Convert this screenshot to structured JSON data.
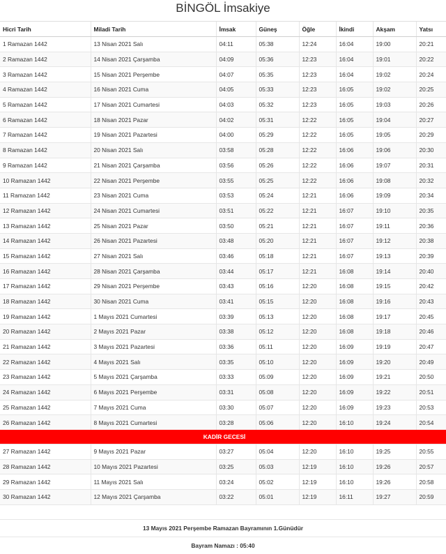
{
  "title": "BİNGÖL İmsakiye",
  "columns": [
    "Hicri Tarih",
    "Miladi Tarih",
    "İmsak",
    "Güneş",
    "Öğle",
    "İkindi",
    "Akşam",
    "Yatsı"
  ],
  "rows_before": [
    [
      "1 Ramazan 1442",
      "13 Nisan 2021 Salı",
      "04:11",
      "05:38",
      "12:24",
      "16:04",
      "19:00",
      "20:21"
    ],
    [
      "2 Ramazan 1442",
      "14 Nisan 2021 Çarşamba",
      "04:09",
      "05:36",
      "12:23",
      "16:04",
      "19:01",
      "20:22"
    ],
    [
      "3 Ramazan 1442",
      "15 Nisan 2021 Perşembe",
      "04:07",
      "05:35",
      "12:23",
      "16:04",
      "19:02",
      "20:24"
    ],
    [
      "4 Ramazan 1442",
      "16 Nisan 2021 Cuma",
      "04:05",
      "05:33",
      "12:23",
      "16:05",
      "19:02",
      "20:25"
    ],
    [
      "5 Ramazan 1442",
      "17 Nisan 2021 Cumartesi",
      "04:03",
      "05:32",
      "12:23",
      "16:05",
      "19:03",
      "20:26"
    ],
    [
      "6 Ramazan 1442",
      "18 Nisan 2021 Pazar",
      "04:02",
      "05:31",
      "12:22",
      "16:05",
      "19:04",
      "20:27"
    ],
    [
      "7 Ramazan 1442",
      "19 Nisan 2021 Pazartesi",
      "04:00",
      "05:29",
      "12:22",
      "16:05",
      "19:05",
      "20:29"
    ],
    [
      "8 Ramazan 1442",
      "20 Nisan 2021 Salı",
      "03:58",
      "05:28",
      "12:22",
      "16:06",
      "19:06",
      "20:30"
    ],
    [
      "9 Ramazan 1442",
      "21 Nisan 2021 Çarşamba",
      "03:56",
      "05:26",
      "12:22",
      "16:06",
      "19:07",
      "20:31"
    ],
    [
      "10 Ramazan 1442",
      "22 Nisan 2021 Perşembe",
      "03:55",
      "05:25",
      "12:22",
      "16:06",
      "19:08",
      "20:32"
    ],
    [
      "11 Ramazan 1442",
      "23 Nisan 2021 Cuma",
      "03:53",
      "05:24",
      "12:21",
      "16:06",
      "19:09",
      "20:34"
    ],
    [
      "12 Ramazan 1442",
      "24 Nisan 2021 Cumartesi",
      "03:51",
      "05:22",
      "12:21",
      "16:07",
      "19:10",
      "20:35"
    ],
    [
      "13 Ramazan 1442",
      "25 Nisan 2021 Pazar",
      "03:50",
      "05:21",
      "12:21",
      "16:07",
      "19:11",
      "20:36"
    ],
    [
      "14 Ramazan 1442",
      "26 Nisan 2021 Pazartesi",
      "03:48",
      "05:20",
      "12:21",
      "16:07",
      "19:12",
      "20:38"
    ],
    [
      "15 Ramazan 1442",
      "27 Nisan 2021 Salı",
      "03:46",
      "05:18",
      "12:21",
      "16:07",
      "19:13",
      "20:39"
    ],
    [
      "16 Ramazan 1442",
      "28 Nisan 2021 Çarşamba",
      "03:44",
      "05:17",
      "12:21",
      "16:08",
      "19:14",
      "20:40"
    ],
    [
      "17 Ramazan 1442",
      "29 Nisan 2021 Perşembe",
      "03:43",
      "05:16",
      "12:20",
      "16:08",
      "19:15",
      "20:42"
    ],
    [
      "18 Ramazan 1442",
      "30 Nisan 2021 Cuma",
      "03:41",
      "05:15",
      "12:20",
      "16:08",
      "19:16",
      "20:43"
    ],
    [
      "19 Ramazan 1442",
      "1 Mayıs 2021 Cumartesi",
      "03:39",
      "05:13",
      "12:20",
      "16:08",
      "19:17",
      "20:45"
    ],
    [
      "20 Ramazan 1442",
      "2 Mayıs 2021 Pazar",
      "03:38",
      "05:12",
      "12:20",
      "16:08",
      "19:18",
      "20:46"
    ],
    [
      "21 Ramazan 1442",
      "3 Mayıs 2021 Pazartesi",
      "03:36",
      "05:11",
      "12:20",
      "16:09",
      "19:19",
      "20:47"
    ],
    [
      "22 Ramazan 1442",
      "4 Mayıs 2021 Salı",
      "03:35",
      "05:10",
      "12:20",
      "16:09",
      "19:20",
      "20:49"
    ],
    [
      "23 Ramazan 1442",
      "5 Mayıs 2021 Çarşamba",
      "03:33",
      "05:09",
      "12:20",
      "16:09",
      "19:21",
      "20:50"
    ],
    [
      "24 Ramazan 1442",
      "6 Mayıs 2021 Perşembe",
      "03:31",
      "05:08",
      "12:20",
      "16:09",
      "19:22",
      "20:51"
    ],
    [
      "25 Ramazan 1442",
      "7 Mayıs 2021 Cuma",
      "03:30",
      "05:07",
      "12:20",
      "16:09",
      "19:23",
      "20:53"
    ],
    [
      "26 Ramazan 1442",
      "8 Mayıs 2021 Cumartesi",
      "03:28",
      "05:06",
      "12:20",
      "16:10",
      "19:24",
      "20:54"
    ]
  ],
  "kadir_label": "KADİR GECESİ",
  "rows_after": [
    [
      "27 Ramazan 1442",
      "9 Mayıs 2021 Pazar",
      "03:27",
      "05:04",
      "12:20",
      "16:10",
      "19:25",
      "20:55"
    ],
    [
      "28 Ramazan 1442",
      "10 Mayıs 2021 Pazartesi",
      "03:25",
      "05:03",
      "12:19",
      "16:10",
      "19:26",
      "20:57"
    ],
    [
      "29 Ramazan 1442",
      "11 Mayıs 2021 Salı",
      "03:24",
      "05:02",
      "12:19",
      "16:10",
      "19:26",
      "20:58"
    ],
    [
      "30 Ramazan 1442",
      "12 Mayıs 2021 Çarşamba",
      "03:22",
      "05:01",
      "12:19",
      "16:11",
      "19:27",
      "20:59"
    ]
  ],
  "bayram_text": "13 Mayıs 2021 Perşembe Ramazan Bayramının 1.Günüdür",
  "bayram_namazi_text": "Bayram Namazı : 05:40",
  "colors": {
    "kadir_bg": "#ff0000",
    "kadir_text": "#ffffff"
  }
}
